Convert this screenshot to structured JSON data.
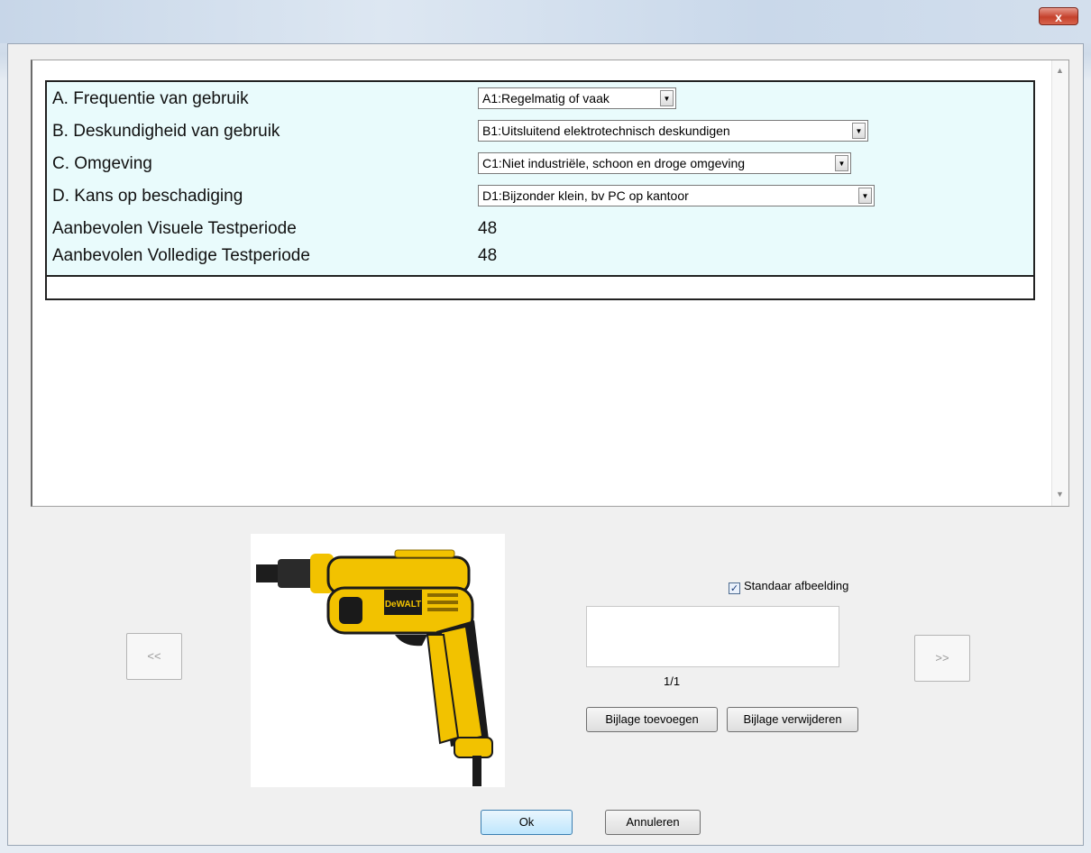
{
  "window": {
    "close_label": "x"
  },
  "form": {
    "rows": [
      {
        "label": "A. Frequentie van gebruik",
        "value": "A1:Regelmatig of vaak"
      },
      {
        "label": "B. Deskundigheid van gebruik",
        "value": "B1:Uitsluitend elektrotechnisch deskundigen"
      },
      {
        "label": "C. Omgeving",
        "value": "C1:Niet industriële, schoon en droge omgeving"
      },
      {
        "label": "D. Kans op beschadiging",
        "value": "D1:Bijzonder klein, bv PC op kantoor"
      }
    ],
    "visual_period": {
      "label": "Aanbevolen Visuele Testperiode",
      "value": "48"
    },
    "full_period": {
      "label": "Aanbevolen Volledige Testperiode",
      "value": "48"
    }
  },
  "attachments": {
    "prev_label": "<<",
    "next_label": ">>",
    "image_brand": "DeWALT",
    "standard_image_label": "Standaar afbeelding",
    "standard_image_checked": true,
    "counter": "1/1",
    "add_label": "Bijlage toevoegen",
    "remove_label": "Bijlage verwijderen"
  },
  "footer": {
    "ok_label": "Ok",
    "cancel_label": "Annuleren"
  }
}
